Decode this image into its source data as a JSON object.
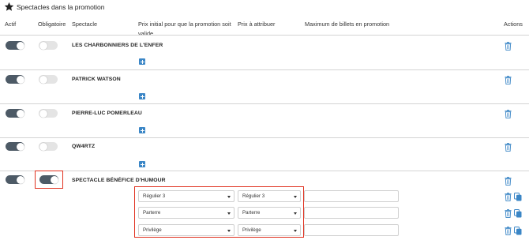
{
  "section": {
    "title": "Spectacles dans la promotion",
    "icon": "star-icon"
  },
  "columns": {
    "actif": "Actif",
    "obligatoire": "Obligatoire",
    "spectacle": "Spectacle",
    "prix_initial_line1": "Prix initial pour que la promotion soit",
    "prix_initial_line2": "valide",
    "prix_attribuer": "Prix à attribuer",
    "maximum": "Maximum de billets en promotion",
    "actions": "Actions"
  },
  "rows": [
    {
      "name": "LES CHARBONNIERS DE L'ENFER",
      "actif": true,
      "obligatoire": false
    },
    {
      "name": "PATRICK WATSON",
      "actif": true,
      "obligatoire": false
    },
    {
      "name": "PIERRE-LUC POMERLEAU",
      "actif": true,
      "obligatoire": false
    },
    {
      "name": "QW4RTZ",
      "actif": true,
      "obligatoire": false
    },
    {
      "name": "SPECTACLE BÉNÉFICE D'HUMOUR",
      "actif": true,
      "obligatoire": true,
      "price_rules": [
        {
          "prix_initial": "Régulier 3",
          "prix_attribuer": "Régulier 3",
          "maximum": ""
        },
        {
          "prix_initial": "Parterre",
          "prix_attribuer": "Parterre",
          "maximum": ""
        },
        {
          "prix_initial": "Privilège",
          "prix_attribuer": "Privilège",
          "maximum": ""
        }
      ]
    }
  ],
  "colors": {
    "toggle_on": "#4d5a66",
    "toggle_off": "#e4e4e4",
    "accent_blue": "#3b86c6",
    "highlight_red": "#e0301e"
  }
}
